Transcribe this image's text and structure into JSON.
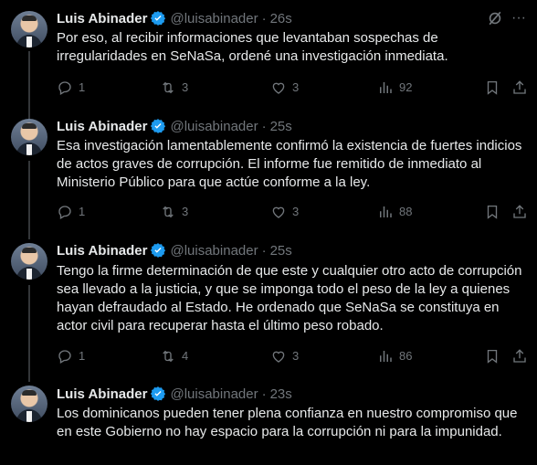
{
  "tweets": [
    {
      "name": "Luis Abinader",
      "handle": "@luisabinader",
      "time": "26s",
      "text": "Por eso, al recibir informaciones que levantaban sospechas de irregularidades en SeNaSa, ordené una investigación inmediata.",
      "replies": "1",
      "retweets": "3",
      "likes": "3",
      "views": "92"
    },
    {
      "name": "Luis Abinader",
      "handle": "@luisabinader",
      "time": "25s",
      "text": "Esa investigación lamentablemente confirmó la existencia de fuertes indicios de actos graves de corrupción. El informe fue remitido de inmediato al Ministerio Público para que actúe conforme a la ley.",
      "replies": "1",
      "retweets": "3",
      "likes": "3",
      "views": "88"
    },
    {
      "name": "Luis Abinader",
      "handle": "@luisabinader",
      "time": "25s",
      "text": "Tengo la firme determinación de que este y cualquier otro acto de corrupción sea llevado a la justicia, y que se imponga todo el peso de la ley a quienes hayan defraudado al Estado. He ordenado que SeNaSa se constituya en actor civil para recuperar hasta el último peso robado.",
      "replies": "1",
      "retweets": "4",
      "likes": "3",
      "views": "86"
    },
    {
      "name": "Luis Abinader",
      "handle": "@luisabinader",
      "time": "23s",
      "text": "Los dominicanos pueden tener plena confianza en nuestro compromiso que en este Gobierno no hay espacio para la corrupción ni para la impunidad."
    }
  ],
  "separator": "·",
  "more_glyph": "···",
  "colors": {
    "background": "#000000",
    "text": "#e7e9ea",
    "muted": "#71767b",
    "verified": "#1d9bf0",
    "thread_line": "#333639"
  },
  "icons": [
    "verified-badge-icon",
    "grok-icon",
    "more-icon",
    "reply-icon",
    "retweet-icon",
    "like-icon",
    "views-icon",
    "bookmark-icon",
    "share-icon"
  ]
}
